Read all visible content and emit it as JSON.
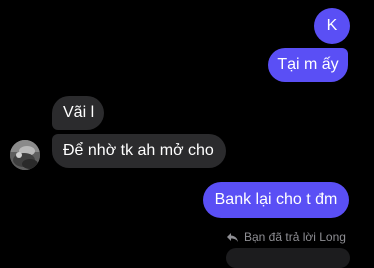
{
  "messages": [
    {
      "side": "outgoing",
      "text": "K"
    },
    {
      "side": "outgoing",
      "text": "Tại m ấy"
    },
    {
      "side": "incoming",
      "text": "Vãi l"
    },
    {
      "side": "incoming",
      "text": "Để nhờ tk ah mở cho"
    },
    {
      "side": "outgoing",
      "text": "Bank lại cho t đm"
    }
  ],
  "reply_note": {
    "icon": "reply-arrow-icon",
    "text": "Bạn đã trả lời Long"
  },
  "colors": {
    "outgoing_bubble": "#5a4ff5",
    "incoming_bubble": "#2b2b2d",
    "background": "#000000",
    "muted_text": "#8e8e93"
  }
}
